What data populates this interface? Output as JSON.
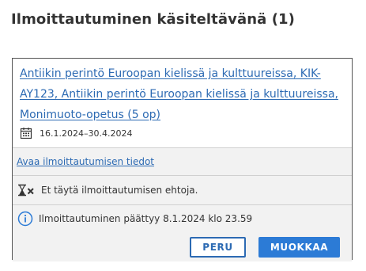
{
  "page": {
    "title": "Ilmoittautuminen käsiteltävänä (1)"
  },
  "enrollment": {
    "course_line1": "Antiikin perintö Euroopan kielissä ja kulttuureissa, KIK-",
    "course_line2": "AY123, Antiikin perintö Euroopan kielissä ja kulttuureissa,",
    "course_line3": "Monimuoto-opetus (5 op)",
    "date_range": "16.1.2024–30.4.2024",
    "details_link": "Avaa ilmoittautumisen tiedot",
    "warning_text": "Et täytä ilmoittautumisen ehtoja.",
    "info_text": "Ilmoittautuminen päättyy 8.1.2024 klo 23.59",
    "cancel_label": "PERU",
    "edit_label": "MUOKKAA"
  },
  "icons": {
    "calendar": "calendar-icon",
    "hourglass_x": "hourglass-x-icon",
    "info": "info-icon"
  },
  "colors": {
    "link": "#2c6ab3",
    "primary_button": "#2c7bd6",
    "info_icon": "#2c7bd6",
    "section_bg": "#f2f2f2"
  }
}
